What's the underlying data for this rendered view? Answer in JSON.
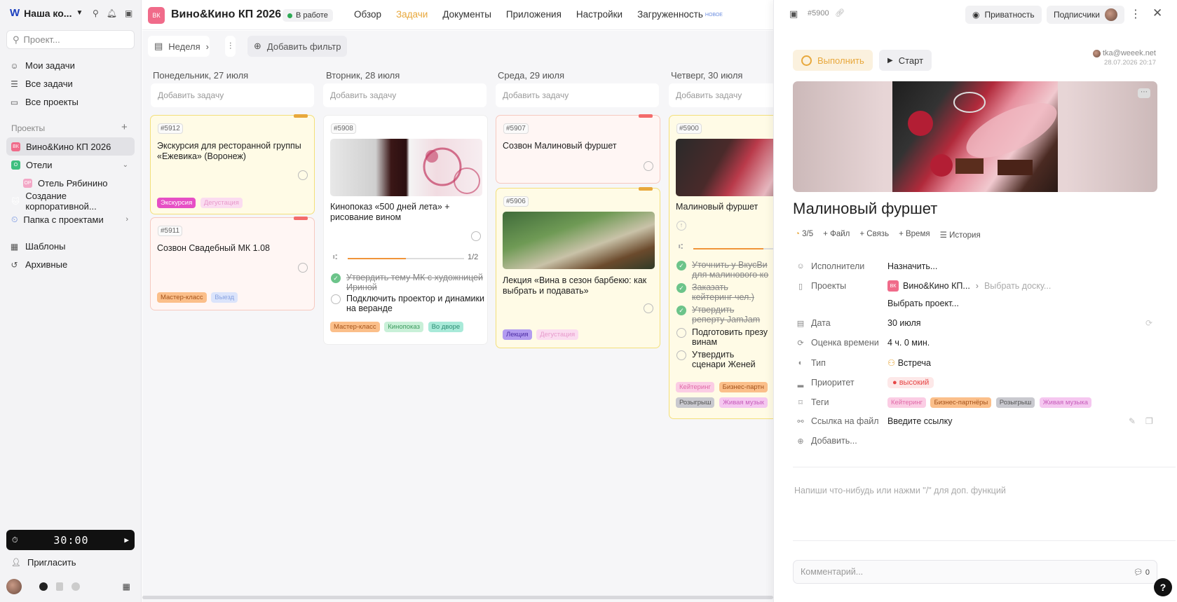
{
  "sidebar": {
    "workspace": "Наша ко...",
    "search_placeholder": "Проект...",
    "nav": [
      {
        "label": "Мои задачи",
        "icon": "smile-icon"
      },
      {
        "label": "Все задачи",
        "icon": "tasks-icon"
      },
      {
        "label": "Все проекты",
        "icon": "folder-icon"
      }
    ],
    "projects_title": "Проекты",
    "projects": [
      {
        "label": "Вино&Кино КП 2026",
        "badge": "ВК",
        "color": "#f06b8a",
        "active": true
      },
      {
        "label": "Отели",
        "badge": "О",
        "color": "#3fbf7f"
      },
      {
        "label": "Отель Рябинино",
        "badge": "ОР",
        "color": "#f3a7c6"
      },
      {
        "label": "Создание корпоративной...",
        "badge": "🐱",
        "color": "#e8a83c"
      },
      {
        "label": "Папка с проектами",
        "badge": "",
        "color": "#6b8de0"
      }
    ],
    "templates": "Шаблоны",
    "archive": "Архивные",
    "timer": "30:00",
    "invite": "Пригласить"
  },
  "topbar": {
    "badge": "ВК",
    "title": "Вино&Кино КП 2026",
    "status": "В работе",
    "tabs": [
      "Обзор",
      "Задачи",
      "Документы",
      "Приложения",
      "Настройки",
      "Загруженность"
    ],
    "active_tab": "Задачи",
    "new_badge": "НОВОЕ"
  },
  "board": {
    "week": "Неделя",
    "add_filter": "Добавить фильтр",
    "add_task": "Добавить задачу",
    "columns": [
      "Понедельник, 27 июля",
      "Вторник, 28 июля",
      "Среда, 29 июля",
      "Четверг, 30 июля"
    ],
    "cards": {
      "c5912": {
        "id": "#5912",
        "title": "Экскурсия для ресторанной группы «Ежевика» (Воронеж)",
        "tags": [
          "Экскурсия",
          "Дегустация"
        ]
      },
      "c5911": {
        "id": "#5911",
        "title": "Созвон Свадебный МК 1.08",
        "tags": [
          "Мастер-класс",
          "Выезд"
        ]
      },
      "c5908": {
        "id": "#5908",
        "title": "Кинопоказ «500 дней лета» + рисование вином",
        "progress": "1/2",
        "checks": [
          "Утвердить тему МК с художницей Ириной",
          "Подключить проектор и динамики на веранде"
        ],
        "tags": [
          "Мастер-класс",
          "Кинопоказ",
          "Во дворе"
        ]
      },
      "c5907": {
        "id": "#5907",
        "title": "Созвон Малиновый фуршет"
      },
      "c5906": {
        "id": "#5906",
        "title": "Лекция «Вина в сезон барбекю: как выбрать и подавать»",
        "tags": [
          "Лекция",
          "Дегустация"
        ]
      },
      "c5900": {
        "id": "#5900",
        "title": "Малиновый фуршет",
        "checks": [
          "Уточнить у ВкусВи для малинового ко",
          "Заказать кейтеринг чел.)",
          "Утвердить реперту JamJam",
          "Подготовить презу винам",
          "Утвердить сценари Женей"
        ],
        "tags": [
          "Кейтеринг",
          "Бизнес-партн",
          "Розыгрыш",
          "Живая музык"
        ]
      }
    }
  },
  "panel": {
    "task_id": "#5900",
    "privacy": "Приватность",
    "subscribers": "Подписчики",
    "complete": "Выполнить",
    "start": "Старт",
    "author": "tka@weeek.net",
    "created": "28.07.2026 20:17",
    "title": "Малиновый фуршет",
    "meta": {
      "progress": "3/5",
      "file": "Файл",
      "link": "Связь",
      "time": "Время",
      "history": "История"
    },
    "fields": {
      "assignees_label": "Исполнители",
      "assignees_value": "Назначить...",
      "projects_label": "Проекты",
      "project_name": "Вино&Кино КП...",
      "board_select": "Выбрать доску...",
      "project_select": "Выбрать проект...",
      "date_label": "Дата",
      "date_value": "30 июля",
      "estimate_label": "Оценка времени",
      "estimate_value": "4 ч. 0 мин.",
      "type_label": "Тип",
      "type_value": "Встреча",
      "priority_label": "Приоритет",
      "priority_value": "высокий",
      "tags_label": "Теги",
      "tags": [
        "Кейтеринг",
        "Бизнес-партнёры",
        "Розыгрыш",
        "Живая музыка"
      ],
      "file_link_label": "Ссылка на файл",
      "file_link_placeholder": "Введите ссылку",
      "add": "Добавить..."
    },
    "editor_placeholder": "Напиши что-нибудь или нажми \"/\" для доп. функций",
    "comment_placeholder": "Комментарий...",
    "comment_count": "0",
    "help": "?"
  },
  "colors": {
    "accent": "#e8a83c",
    "brand": "#1b3fbf",
    "project": "#f06b8a"
  }
}
